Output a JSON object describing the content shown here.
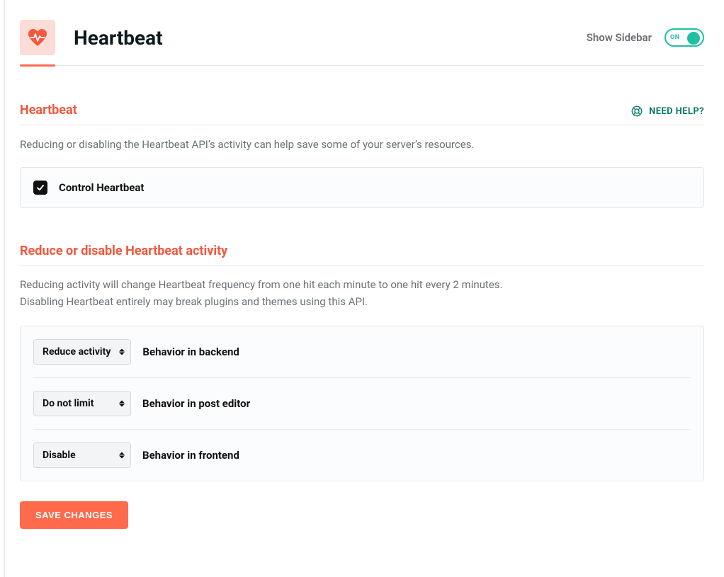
{
  "header": {
    "title": "Heartbeat",
    "show_sidebar_label": "Show Sidebar",
    "toggle_on_text": "ON"
  },
  "section1": {
    "title": "Heartbeat",
    "need_help_label": "NEED HELP?",
    "description": "Reducing or disabling the Heartbeat API’s activity can help save some of your server’s resources.",
    "checkbox_label": "Control Heartbeat",
    "checkbox_checked": true
  },
  "section2": {
    "title": "Reduce or disable Heartbeat activity",
    "description_line1": "Reducing activity will change Heartbeat frequency from one hit each minute to one hit every 2 minutes.",
    "description_line2": "Disabling Heartbeat entirely may break plugins and themes using this API.",
    "rows": [
      {
        "selected": "Reduce activity",
        "label": "Behavior in backend"
      },
      {
        "selected": "Do not limit",
        "label": "Behavior in post editor"
      },
      {
        "selected": "Disable",
        "label": "Behavior in frontend"
      }
    ]
  },
  "save_button_label": "SAVE CHANGES",
  "colors": {
    "accent": "#f4573b",
    "accent_fill": "#ff6a4d",
    "teal": "#1fbfa4",
    "teal_dark": "#0b7a68"
  }
}
